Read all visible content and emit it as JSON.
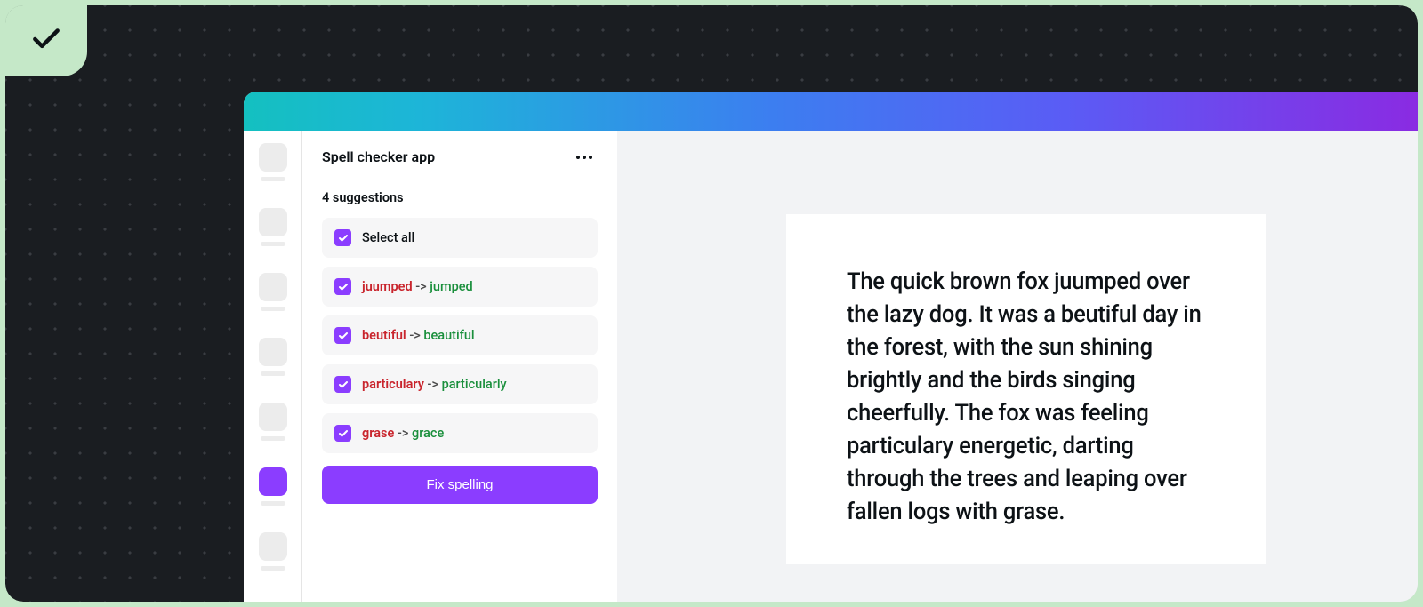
{
  "panel": {
    "title": "Spell checker app",
    "count_label": "4 suggestions",
    "select_all": "Select all",
    "fix_button": "Fix spelling",
    "arrow": "->"
  },
  "suggestions": [
    {
      "wrong": "juumped",
      "right": "jumped"
    },
    {
      "wrong": "beutiful",
      "right": "beautiful"
    },
    {
      "wrong": "particulary ",
      "right": "particularly"
    },
    {
      "wrong": "grase",
      "right": "grace"
    }
  ],
  "document": {
    "text": "The quick brown fox juumped over the lazy dog. It was a beutiful day in the forest, with the sun shining brightly and the birds singing cheerfully. The fox was feeling particulary energetic, darting through the trees and leaping over fallen logs with grase."
  },
  "colors": {
    "accent": "#8b3dff",
    "error": "#c9252d",
    "success": "#1a8f3c"
  }
}
